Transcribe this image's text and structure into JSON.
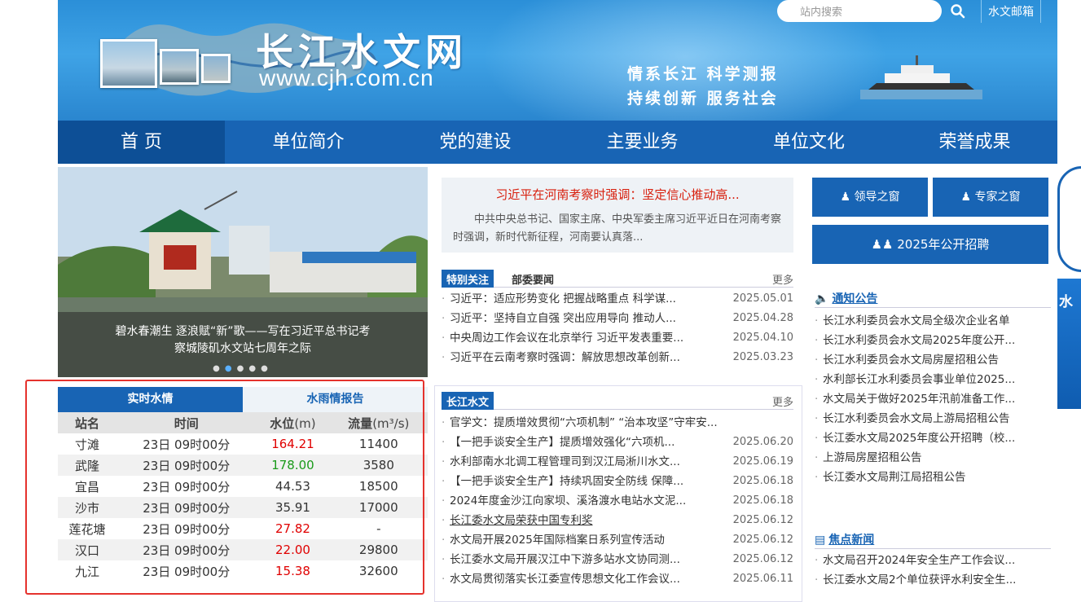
{
  "header": {
    "title": "长江水文网",
    "url": "www.cjh.com.cn",
    "slogan_line1": "情系长江  科学测报",
    "slogan_line2": "持续创新  服务社会",
    "search_placeholder": "站内搜索",
    "mail_label": "水文邮箱"
  },
  "nav": [
    "首 页",
    "单位简介",
    "党的建设",
    "主要业务",
    "单位文化",
    "荣誉成果"
  ],
  "slider": {
    "caption_line1": "碧水春潮生 逐浪赋“新”歌——写在习近平总书记考",
    "caption_line2": "察城陵矶水文站七周年之际"
  },
  "water": {
    "tabs": [
      "实时水情",
      "水雨情报告"
    ],
    "headers": {
      "station": "站名",
      "time": "时间",
      "level": "水位",
      "level_unit": "(m)",
      "flow": "流量",
      "flow_unit": "(m³/s)"
    },
    "rows": [
      {
        "station": "寸滩",
        "time": "23日 09时00分",
        "level": "164.21",
        "flow": "11400",
        "color": "#e00000"
      },
      {
        "station": "武隆",
        "time": "23日 09时00分",
        "level": "178.00",
        "flow": "3580",
        "color": "#1a9a1a"
      },
      {
        "station": "宜昌",
        "time": "23日 09时00分",
        "level": "44.53",
        "flow": "18500",
        "color": "#333333"
      },
      {
        "station": "沙市",
        "time": "23日 09时00分",
        "level": "35.91",
        "flow": "17000",
        "color": "#333333"
      },
      {
        "station": "莲花塘",
        "time": "23日 09时00分",
        "level": "27.82",
        "flow": "-",
        "color": "#e00000"
      },
      {
        "station": "汉口",
        "time": "23日 09时00分",
        "level": "22.00",
        "flow": "29800",
        "color": "#e00000"
      },
      {
        "station": "九江",
        "time": "23日 09时00分",
        "level": "15.38",
        "flow": "32600",
        "color": "#e00000"
      }
    ]
  },
  "top_story": {
    "title": "习近平在河南考察时强调：坚定信心推动高...",
    "desc": "中共中央总书记、国家主席、中央军委主席习近平近日在河南考察时强调，新时代新征程，河南要认真落..."
  },
  "focus": {
    "tag": "特别关注",
    "tag2": "部委要闻",
    "more": "更多",
    "items": [
      {
        "text": "习近平：适应形势变化 把握战略重点 科学谋...",
        "date": "2025.05.01"
      },
      {
        "text": "习近平：坚持自立自强 突出应用导向 推动人...",
        "date": "2025.04.28"
      },
      {
        "text": "中央周边工作会议在北京举行 习近平发表重要...",
        "date": "2025.04.10"
      },
      {
        "text": "习近平在云南考察时强调：解放思想改革创新...",
        "date": "2025.03.23"
      }
    ]
  },
  "cj": {
    "tag": "长江水文",
    "more": "更多",
    "items": [
      {
        "text": "官学文：提质增效贯彻“六项机制” “治本攻坚”守牢安...",
        "date": ""
      },
      {
        "text": "【一把手谈安全生产】提质增效强化“六项机...",
        "date": "2025.06.20"
      },
      {
        "text": "水利部南水北调工程管理司到汉江局淅川水文...",
        "date": "2025.06.19"
      },
      {
        "text": "【一把手谈安全生产】持续巩固安全防线 保障...",
        "date": "2025.06.18"
      },
      {
        "text": "2024年度金沙江向家坝、溪洛渡水电站水文泥...",
        "date": "2025.06.18"
      },
      {
        "text": "长江委水文局荣获中国专利奖",
        "date": "2025.06.12"
      },
      {
        "text": "水文局开展2025年国际档案日系列宣传活动",
        "date": "2025.06.12"
      },
      {
        "text": "长江委水文局开展汉江中下游多站水文协同测...",
        "date": "2025.06.12"
      },
      {
        "text": "水文局贯彻落实长江委宣传思想文化工作会议...",
        "date": "2025.06.11"
      }
    ]
  },
  "right": {
    "leader": "领导之窗",
    "expert": "专家之窗",
    "recruit": "2025年公开招聘",
    "notice_title": "通知公告",
    "notices": [
      "长江水利委员会水文局全级次企业名单",
      "长江水利委员会水文局2025年度公开...",
      "长江水利委员会水文局房屋招租公告",
      "水利部长江水利委员会事业单位2025...",
      "水文局关于做好2025年汛前准备工作...",
      "长江水利委员会水文局上游局招租公告",
      "长江委水文局2025年度公开招聘（校...",
      "上游局房屋招租公告",
      "长江委水文局荆江局招租公告"
    ],
    "focus_title": "焦点新闻",
    "focus_news": [
      "水文局召开2024年安全生产工作会议...",
      "长江委水文局2个单位获评水利安全生..."
    ],
    "side_text": "水"
  }
}
